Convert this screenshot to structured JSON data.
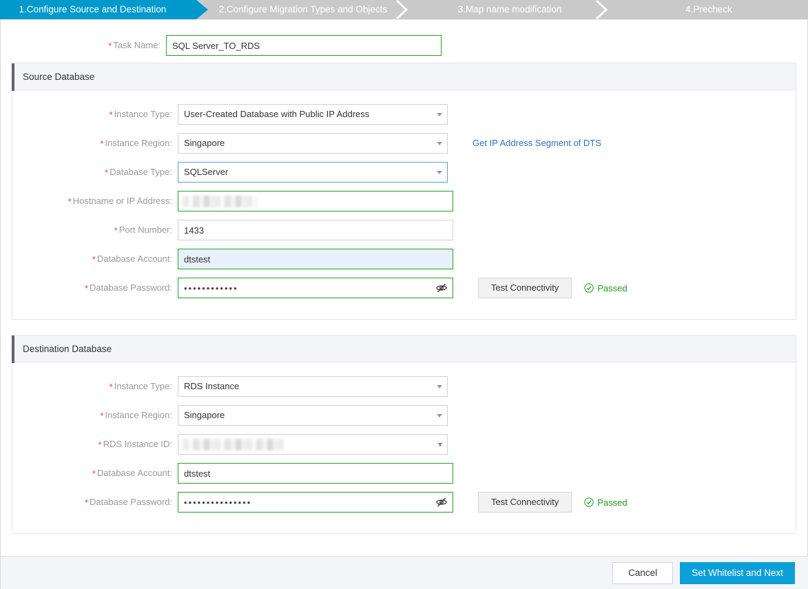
{
  "stepper": {
    "steps": [
      {
        "label": "1.Configure Source and Destination",
        "active": true
      },
      {
        "label": "2.Configure Migration Types and Objects",
        "active": false
      },
      {
        "label": "3.Map name modification",
        "active": false
      },
      {
        "label": "4.Precheck",
        "active": false
      }
    ],
    "active_color": "#0099cc",
    "inactive_color": "#c9c9c9"
  },
  "task": {
    "name_label": "Task Name:",
    "name_value": "SQL Server_TO_RDS"
  },
  "source": {
    "section_title": "Source Database",
    "instance_type_label": "Instance Type:",
    "instance_type_value": "User-Created Database with Public IP Address",
    "instance_region_label": "Instance Region:",
    "instance_region_value": "Singapore",
    "database_type_label": "Database Type:",
    "database_type_value": "SQLServer",
    "hostname_label": "Hostname or IP Address:",
    "hostname_value": "",
    "port_label": "Port Number:",
    "port_value": "1433",
    "account_label": "Database Account:",
    "account_value": "dtstest",
    "password_label": "Database Password:",
    "password_value": "••••••••••••",
    "test_button": "Test Connectivity",
    "test_status": "Passed",
    "ip_link": "Get IP Address Segment of DTS"
  },
  "destination": {
    "section_title": "Destination Database",
    "instance_type_label": "Instance Type:",
    "instance_type_value": "RDS Instance",
    "instance_region_label": "Instance Region:",
    "instance_region_value": "Singapore",
    "rds_id_label": "RDS Instance ID:",
    "rds_id_value": "",
    "account_label": "Database Account:",
    "account_value": "dtstest",
    "password_label": "Database Password:",
    "password_value": "•••••••••••••••",
    "test_button": "Test Connectivity",
    "test_status": "Passed"
  },
  "footer": {
    "cancel_label": "Cancel",
    "next_label": "Set Whitelist and Next",
    "primary_color": "#0d9fd8"
  },
  "colors": {
    "valid_border": "#1ea61e",
    "focus_border": "#5a9fd4",
    "required_star": "#ff3b30",
    "success_text": "#1aa111",
    "link": "#2b6ecb"
  }
}
